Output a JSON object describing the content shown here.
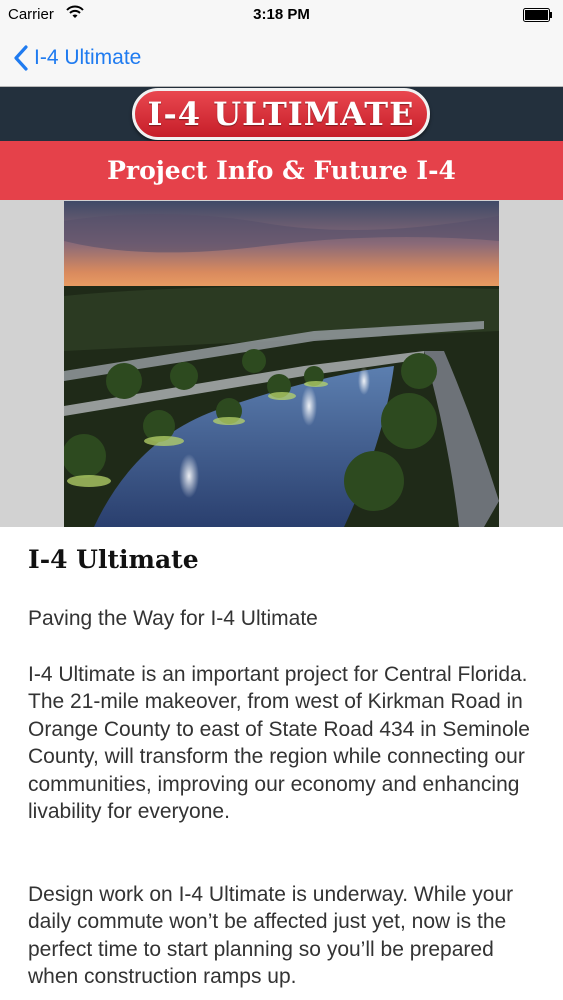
{
  "status_bar": {
    "carrier": "Carrier",
    "time": "3:18 PM"
  },
  "nav": {
    "back_label": "I-4 Ultimate"
  },
  "header": {
    "logo_text": "I-4 ULTIMATE",
    "section_title": "Project Info & Future I-4"
  },
  "article": {
    "title": "I-4 Ultimate",
    "subtitle": "Paving the Way for I-4 Ultimate",
    "paragraphs": [
      "I-4 Ultimate is an important project for Central Florida. The 21-mile makeover, from west of Kirkman Road in Orange County to east of State Road 434 in Seminole County, will transform the region while connecting our communities, improving our economy and enhancing livability for everyone.",
      "Design work on I-4 Ultimate is underway. While your daily commute won’t be affected just yet, now is the perfect time to start planning so you’ll be prepared when construction ramps up."
    ]
  },
  "colors": {
    "accent_blue": "#1f7bf0",
    "brand_red": "#e5414a",
    "header_dark": "#23303d"
  }
}
